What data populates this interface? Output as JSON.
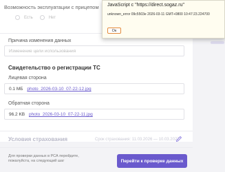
{
  "form": {
    "trailer_label": "Возможность эксплуатации с прицепом",
    "radio_yes": "Есть",
    "radio_no": "Нет",
    "reason_label": "Причина изменения данных",
    "reason_placeholder": "Изменение цели использования",
    "sts_title": "Свидетельство о регистрации ТС",
    "front_label": "Лицевая сторона",
    "front_size": "0.1 МБ",
    "front_file": "photo_2026-03-10_07-22-12.jpg",
    "back_label": "Обратная сторона",
    "back_size": "96.2 KB",
    "back_file": "photo_2026-03-10_07-22-11.jpg"
  },
  "insurance": {
    "title": "Условия страхования",
    "date_text": "Срок страхования: 11.03.2026 — 10.03.2027"
  },
  "footer": {
    "note": "Для проверки данных в РСА перейдите, пожалуйста, на следующий шаг",
    "button_label": "Перейти к проверке данных"
  },
  "dialog": {
    "title": "JavaScript с \"https://direct.sogaz.ru\"",
    "message": "unknown_error 09c5503e 2026-03-11 GMT+0800 10:47:23.224700",
    "ok_label": "Ок"
  },
  "colors": {
    "accent": "#6a5acd",
    "ok_border": "#e38a3a"
  }
}
